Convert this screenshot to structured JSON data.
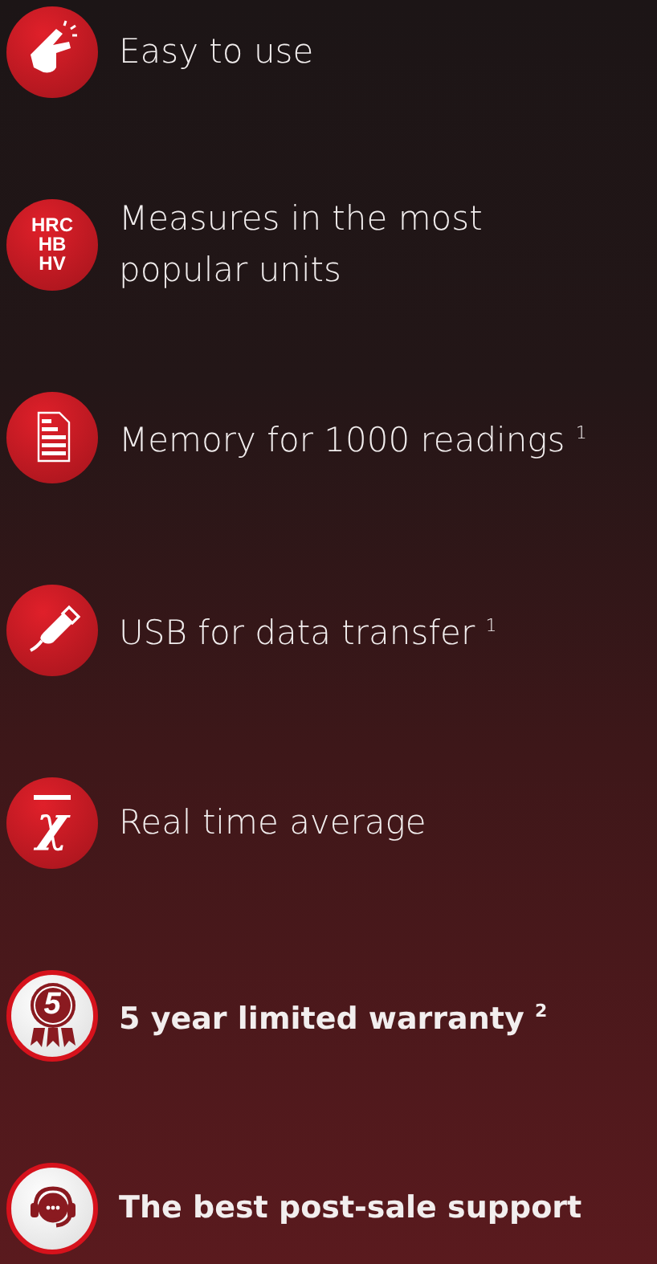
{
  "features": [
    {
      "kind": "hand",
      "label": "Easy to use",
      "bold": false
    },
    {
      "kind": "units",
      "icon_text": [
        "HRC",
        "HB",
        "HV"
      ],
      "label": "Measures in the most popular units",
      "bold": false
    },
    {
      "kind": "document",
      "label": "Memory for 1000 readings $^{1}$",
      "bold": false
    },
    {
      "kind": "usb",
      "label": "USB for data transfer $^{1}$",
      "bold": false
    },
    {
      "kind": "average",
      "icon_text": [
        "χ"
      ],
      "label": "Real time average",
      "bold": false
    },
    {
      "kind": "medal",
      "icon_text": [
        "5"
      ],
      "label": "5 year limited warranty $^{2}$",
      "bold": true
    },
    {
      "kind": "headset",
      "label": "The best post-sale support",
      "bold": true
    }
  ]
}
